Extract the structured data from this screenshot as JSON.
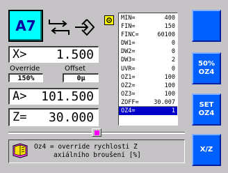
{
  "mode": {
    "label": "A7"
  },
  "fields": {
    "x": {
      "label": "X>",
      "value": "1.500"
    },
    "override": {
      "label": "Override",
      "value": "150%"
    },
    "offset": {
      "label": "Offset",
      "value": "0µ"
    },
    "a": {
      "label": "A>",
      "value": "101.500"
    },
    "z": {
      "label": "Z=",
      "value": "30.000"
    }
  },
  "params": [
    {
      "name": "MIN=",
      "value": "400"
    },
    {
      "name": "FIN=",
      "value": "150"
    },
    {
      "name": "FINC=",
      "value": "60100"
    },
    {
      "name": "DW1=",
      "value": "0"
    },
    {
      "name": "DW2=",
      "value": "0"
    },
    {
      "name": "DW3=",
      "value": "2"
    },
    {
      "name": "UVR=",
      "value": "0"
    },
    {
      "name": "OZ1=",
      "value": "100"
    },
    {
      "name": "OZ2=",
      "value": "100"
    },
    {
      "name": "OZ3=",
      "value": "100"
    },
    {
      "name": "ZOFF=",
      "value": "30.007"
    },
    {
      "name": "OZ4=",
      "value": "1"
    }
  ],
  "buttons": {
    "b50_line1": "50%",
    "b50_line2": "OZ4",
    "set_line1": "SET",
    "set_line2": "OZ4",
    "xz": "X/Z"
  },
  "message": {
    "line1": "Oz4 = override rychlosti Z",
    "line2": "axiálního broušení [%]"
  },
  "slider": {
    "level": 0.5
  },
  "colors": {
    "accent": "#0060ff",
    "mode_bg": "#00ffff",
    "selected": "#0000c8"
  }
}
